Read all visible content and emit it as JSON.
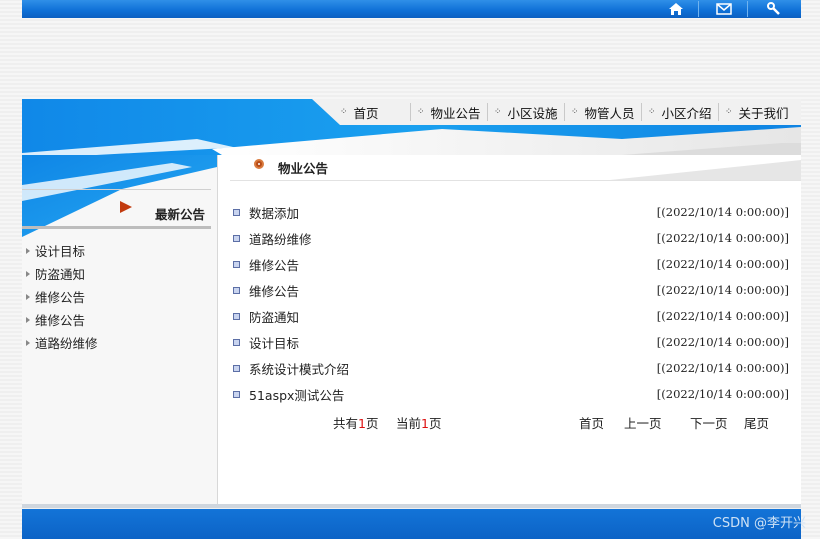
{
  "colors": {
    "brand_blue": "#0e6fd6",
    "accent_orange": "#b74b17",
    "pager_highlight": "#dd1111"
  },
  "top_icons": [
    "home-icon",
    "mail-icon",
    "wrench-icon"
  ],
  "nav": {
    "items": [
      {
        "label": "首页"
      },
      {
        "label": "物业公告"
      },
      {
        "label": "小区设施"
      },
      {
        "label": "物管人员"
      },
      {
        "label": "小区介绍"
      },
      {
        "label": "关于我们"
      }
    ]
  },
  "section": {
    "title": "物业公告"
  },
  "news": [
    {
      "title": "数据添加",
      "date": "[(2022/10/14 0:00:00)]"
    },
    {
      "title": "道路纷维修",
      "date": "[(2022/10/14 0:00:00)]"
    },
    {
      "title": "维修公告",
      "date": "[(2022/10/14 0:00:00)]"
    },
    {
      "title": "维修公告",
      "date": "[(2022/10/14 0:00:00)]"
    },
    {
      "title": "防盗通知",
      "date": "[(2022/10/14 0:00:00)]"
    },
    {
      "title": "设计目标",
      "date": "[(2022/10/14 0:00:00)]"
    },
    {
      "title": "系统设计模式介绍",
      "date": "[(2022/10/14 0:00:00)]"
    },
    {
      "title": "51aspx测试公告",
      "date": "[(2022/10/14 0:00:00)]"
    }
  ],
  "pager": {
    "total_prefix": "共有",
    "total_pages": "1",
    "total_suffix": "页",
    "current_prefix": "当前",
    "current_page": "1",
    "current_suffix": "页",
    "first": "首页",
    "prev": "上一页",
    "next": "下一页",
    "last": "尾页"
  },
  "sidebar": {
    "title": "最新公告",
    "items": [
      {
        "label": "设计目标"
      },
      {
        "label": "防盗通知"
      },
      {
        "label": "维修公告"
      },
      {
        "label": "维修公告"
      },
      {
        "label": "道路纷维修"
      }
    ]
  },
  "watermark": "CSDN @李开兴"
}
